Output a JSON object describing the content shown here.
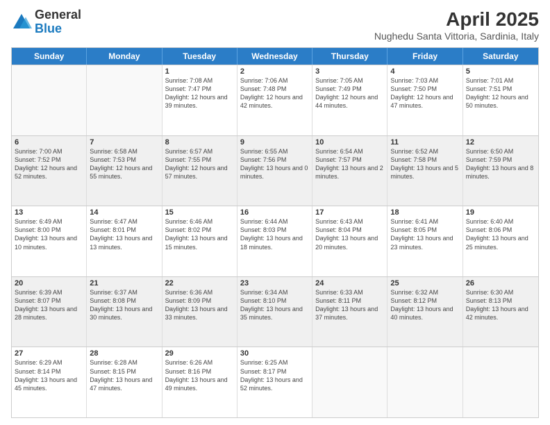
{
  "logo": {
    "general": "General",
    "blue": "Blue"
  },
  "header": {
    "month": "April 2025",
    "location": "Nughedu Santa Vittoria, Sardinia, Italy"
  },
  "weekdays": [
    "Sunday",
    "Monday",
    "Tuesday",
    "Wednesday",
    "Thursday",
    "Friday",
    "Saturday"
  ],
  "rows": [
    [
      {
        "day": "",
        "sunrise": "",
        "sunset": "",
        "daylight": "",
        "empty": true
      },
      {
        "day": "",
        "sunrise": "",
        "sunset": "",
        "daylight": "",
        "empty": true
      },
      {
        "day": "1",
        "sunrise": "Sunrise: 7:08 AM",
        "sunset": "Sunset: 7:47 PM",
        "daylight": "Daylight: 12 hours and 39 minutes.",
        "empty": false
      },
      {
        "day": "2",
        "sunrise": "Sunrise: 7:06 AM",
        "sunset": "Sunset: 7:48 PM",
        "daylight": "Daylight: 12 hours and 42 minutes.",
        "empty": false
      },
      {
        "day": "3",
        "sunrise": "Sunrise: 7:05 AM",
        "sunset": "Sunset: 7:49 PM",
        "daylight": "Daylight: 12 hours and 44 minutes.",
        "empty": false
      },
      {
        "day": "4",
        "sunrise": "Sunrise: 7:03 AM",
        "sunset": "Sunset: 7:50 PM",
        "daylight": "Daylight: 12 hours and 47 minutes.",
        "empty": false
      },
      {
        "day": "5",
        "sunrise": "Sunrise: 7:01 AM",
        "sunset": "Sunset: 7:51 PM",
        "daylight": "Daylight: 12 hours and 50 minutes.",
        "empty": false
      }
    ],
    [
      {
        "day": "6",
        "sunrise": "Sunrise: 7:00 AM",
        "sunset": "Sunset: 7:52 PM",
        "daylight": "Daylight: 12 hours and 52 minutes.",
        "empty": false
      },
      {
        "day": "7",
        "sunrise": "Sunrise: 6:58 AM",
        "sunset": "Sunset: 7:53 PM",
        "daylight": "Daylight: 12 hours and 55 minutes.",
        "empty": false
      },
      {
        "day": "8",
        "sunrise": "Sunrise: 6:57 AM",
        "sunset": "Sunset: 7:55 PM",
        "daylight": "Daylight: 12 hours and 57 minutes.",
        "empty": false
      },
      {
        "day": "9",
        "sunrise": "Sunrise: 6:55 AM",
        "sunset": "Sunset: 7:56 PM",
        "daylight": "Daylight: 13 hours and 0 minutes.",
        "empty": false
      },
      {
        "day": "10",
        "sunrise": "Sunrise: 6:54 AM",
        "sunset": "Sunset: 7:57 PM",
        "daylight": "Daylight: 13 hours and 2 minutes.",
        "empty": false
      },
      {
        "day": "11",
        "sunrise": "Sunrise: 6:52 AM",
        "sunset": "Sunset: 7:58 PM",
        "daylight": "Daylight: 13 hours and 5 minutes.",
        "empty": false
      },
      {
        "day": "12",
        "sunrise": "Sunrise: 6:50 AM",
        "sunset": "Sunset: 7:59 PM",
        "daylight": "Daylight: 13 hours and 8 minutes.",
        "empty": false
      }
    ],
    [
      {
        "day": "13",
        "sunrise": "Sunrise: 6:49 AM",
        "sunset": "Sunset: 8:00 PM",
        "daylight": "Daylight: 13 hours and 10 minutes.",
        "empty": false
      },
      {
        "day": "14",
        "sunrise": "Sunrise: 6:47 AM",
        "sunset": "Sunset: 8:01 PM",
        "daylight": "Daylight: 13 hours and 13 minutes.",
        "empty": false
      },
      {
        "day": "15",
        "sunrise": "Sunrise: 6:46 AM",
        "sunset": "Sunset: 8:02 PM",
        "daylight": "Daylight: 13 hours and 15 minutes.",
        "empty": false
      },
      {
        "day": "16",
        "sunrise": "Sunrise: 6:44 AM",
        "sunset": "Sunset: 8:03 PM",
        "daylight": "Daylight: 13 hours and 18 minutes.",
        "empty": false
      },
      {
        "day": "17",
        "sunrise": "Sunrise: 6:43 AM",
        "sunset": "Sunset: 8:04 PM",
        "daylight": "Daylight: 13 hours and 20 minutes.",
        "empty": false
      },
      {
        "day": "18",
        "sunrise": "Sunrise: 6:41 AM",
        "sunset": "Sunset: 8:05 PM",
        "daylight": "Daylight: 13 hours and 23 minutes.",
        "empty": false
      },
      {
        "day": "19",
        "sunrise": "Sunrise: 6:40 AM",
        "sunset": "Sunset: 8:06 PM",
        "daylight": "Daylight: 13 hours and 25 minutes.",
        "empty": false
      }
    ],
    [
      {
        "day": "20",
        "sunrise": "Sunrise: 6:39 AM",
        "sunset": "Sunset: 8:07 PM",
        "daylight": "Daylight: 13 hours and 28 minutes.",
        "empty": false
      },
      {
        "day": "21",
        "sunrise": "Sunrise: 6:37 AM",
        "sunset": "Sunset: 8:08 PM",
        "daylight": "Daylight: 13 hours and 30 minutes.",
        "empty": false
      },
      {
        "day": "22",
        "sunrise": "Sunrise: 6:36 AM",
        "sunset": "Sunset: 8:09 PM",
        "daylight": "Daylight: 13 hours and 33 minutes.",
        "empty": false
      },
      {
        "day": "23",
        "sunrise": "Sunrise: 6:34 AM",
        "sunset": "Sunset: 8:10 PM",
        "daylight": "Daylight: 13 hours and 35 minutes.",
        "empty": false
      },
      {
        "day": "24",
        "sunrise": "Sunrise: 6:33 AM",
        "sunset": "Sunset: 8:11 PM",
        "daylight": "Daylight: 13 hours and 37 minutes.",
        "empty": false
      },
      {
        "day": "25",
        "sunrise": "Sunrise: 6:32 AM",
        "sunset": "Sunset: 8:12 PM",
        "daylight": "Daylight: 13 hours and 40 minutes.",
        "empty": false
      },
      {
        "day": "26",
        "sunrise": "Sunrise: 6:30 AM",
        "sunset": "Sunset: 8:13 PM",
        "daylight": "Daylight: 13 hours and 42 minutes.",
        "empty": false
      }
    ],
    [
      {
        "day": "27",
        "sunrise": "Sunrise: 6:29 AM",
        "sunset": "Sunset: 8:14 PM",
        "daylight": "Daylight: 13 hours and 45 minutes.",
        "empty": false
      },
      {
        "day": "28",
        "sunrise": "Sunrise: 6:28 AM",
        "sunset": "Sunset: 8:15 PM",
        "daylight": "Daylight: 13 hours and 47 minutes.",
        "empty": false
      },
      {
        "day": "29",
        "sunrise": "Sunrise: 6:26 AM",
        "sunset": "Sunset: 8:16 PM",
        "daylight": "Daylight: 13 hours and 49 minutes.",
        "empty": false
      },
      {
        "day": "30",
        "sunrise": "Sunrise: 6:25 AM",
        "sunset": "Sunset: 8:17 PM",
        "daylight": "Daylight: 13 hours and 52 minutes.",
        "empty": false
      },
      {
        "day": "",
        "sunrise": "",
        "sunset": "",
        "daylight": "",
        "empty": true
      },
      {
        "day": "",
        "sunrise": "",
        "sunset": "",
        "daylight": "",
        "empty": true
      },
      {
        "day": "",
        "sunrise": "",
        "sunset": "",
        "daylight": "",
        "empty": true
      }
    ]
  ]
}
